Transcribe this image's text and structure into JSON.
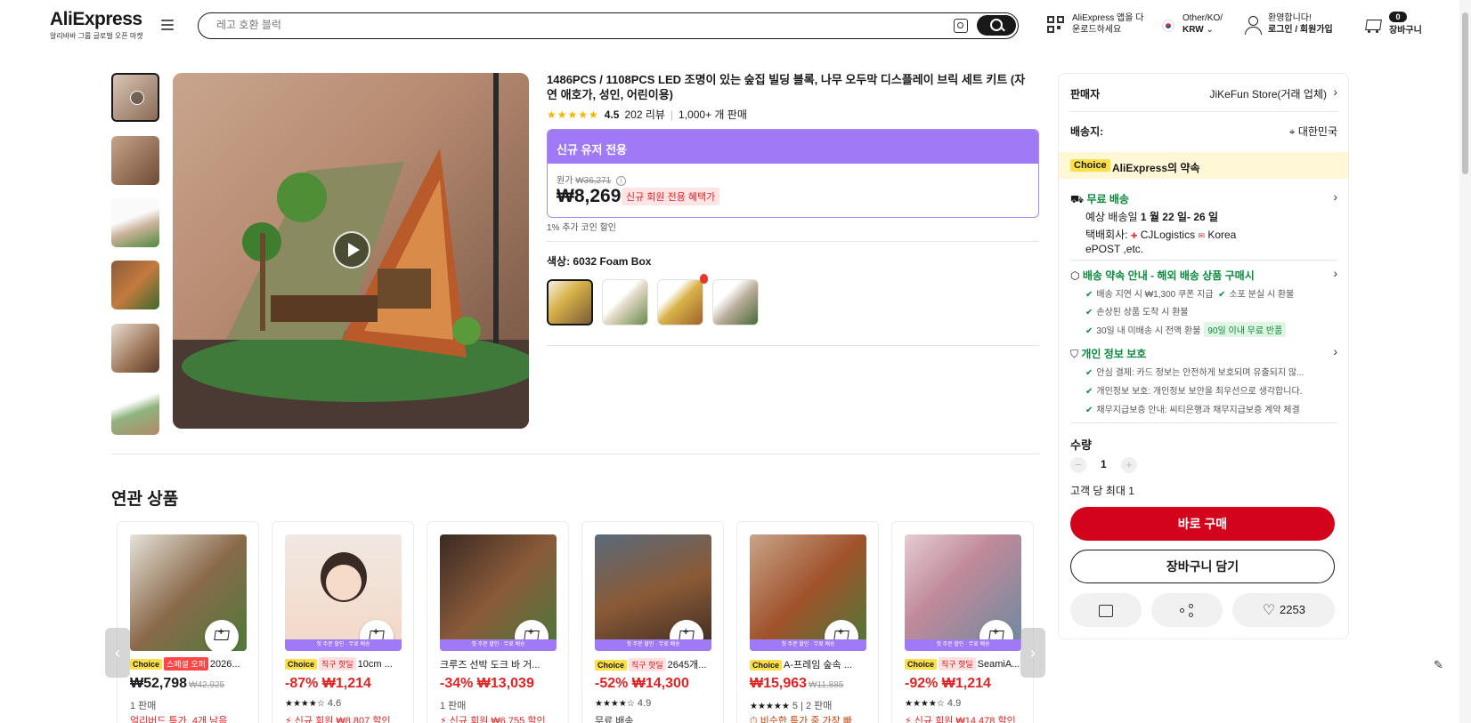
{
  "header": {
    "brand": "AliExpress",
    "brand_sub": "알리바바 그룹 글로벌 오픈 마켓",
    "search_placeholder": "레고 호환 블럭",
    "app_line1": "AliExpress 앱을 다",
    "app_line2": "운로드하세요",
    "locale_line1": "Other/KO/",
    "locale_line2": "KRW",
    "user_line1": "환영합니다!",
    "user_line2": "로그인 / 회원가입",
    "cart_count": "0",
    "cart_label": "장바구니"
  },
  "product": {
    "title": "1486PCS / 1108PCS LED 조명이 있는 숲집 빌딩 블록, 나무 오두막 디스플레이 브릭 세트 키트 (자연 애호가, 성인, 어린이용)",
    "stars": "★★★★★",
    "rating": "4.5",
    "reviews": "202 리뷰",
    "sold": "1,000+ 개 판매",
    "promo_title": "신규 유저 전용",
    "orig_label": "원가",
    "orig_price": "₩36,271",
    "price": "₩8,269",
    "new_member_tag": "신규 회원 전용 혜택가",
    "coin_note": "1% 추가 코인 할인",
    "color_label": "색상: 6032 Foam Box"
  },
  "related": {
    "title": "연관 상품",
    "cards": [
      {
        "tag1": "Choice",
        "tag2": "스페셜 오퍼",
        "name": "2026...",
        "price": "₩52,798",
        "orig": "₩42,925",
        "meta": "1 판매",
        "promo": "얼리버드 특가, 4개 남음"
      },
      {
        "tag1": "Choice",
        "tag2": "직구 핫딜",
        "name": "10cm ...",
        "strip": "첫 주문 할인 · 무료 배송",
        "price": "-87% ₩1,214",
        "stars": "★★★★☆",
        "meta": "4.6",
        "promo": "신규 회원 ₩8,807 할인"
      },
      {
        "name": "크루즈 선박 도크 바 거...",
        "strip": "첫 주문 할인 · 무료 배송",
        "price": "-34% ₩13,039",
        "meta": "1 판매",
        "promo": "신규 회원 ₩6,755 할인"
      },
      {
        "tag1": "Choice",
        "tag2": "직구 핫딜",
        "name": "2645개...",
        "strip": "첫 주문 할인 · 무료 배송",
        "price": "-52% ₩14,300",
        "stars": "★★★★☆",
        "meta": "4.9",
        "promo": "무료 배송"
      },
      {
        "tag1": "Choice",
        "name": "A-프레임 숲속 ...",
        "strip": "첫 주문 할인 · 무료 배송",
        "price": "₩15,963",
        "orig": "₩11,885",
        "stars": "★★★★★",
        "meta": "5 | 2 판매",
        "promo": "비슷한 특가 중 가장 빠"
      },
      {
        "tag1": "Choice",
        "tag2": "직구 핫딜",
        "name": "SeamiA...",
        "strip": "첫 주문 할인 · 무료 배송",
        "price": "-92% ₩1,214",
        "stars": "★★★★☆",
        "meta": "4.9",
        "promo": "신규 회원 ₩14,478 할인"
      }
    ]
  },
  "panel": {
    "seller_label": "판매자",
    "seller_value": "JiKeFun Store(거래 업체)",
    "ship_label": "배송지:",
    "ship_value": "대한민국",
    "choice_tag": "Choice",
    "choice_text": "AliExpress의 약속",
    "free_ship": "무료 배송",
    "eta_prefix": "예상 배송일",
    "eta_value": "1 월 22 일- 26 일",
    "carrier_prefix": "택배회사:",
    "carrier_1": "CJLogistics",
    "carrier_2": "Korea",
    "carrier_3": "ePOST ,etc.",
    "promise_title": "배송 약속 안내 - 해외 배송 상품 구매시",
    "promise_1": "배송 지연 시 ₩1,300 쿠폰 지급",
    "promise_2": "소포 분실 시 환불",
    "promise_3": "손상된 상품 도착 시 환불",
    "promise_4": "30일 내 미배송 시 전액 환불",
    "promise_tag": "90일 이내 무료 반품",
    "privacy_title": "개인 정보 보호",
    "privacy_1": "안심 결제: 카드 정보는 안전하게 보호되며 유출되지 않...",
    "privacy_2": "개인정보 보호: 개인정보 보안을 최우선으로 생각합니다.",
    "privacy_3": "채무지급보증 안내: 씨티은행과 채무지급보증 계약 체결",
    "qty_label": "수량",
    "qty_value": "1",
    "qty_limit": "고객 당 최대 1",
    "buy_now": "바로 구매",
    "add_cart": "장바구니 담기",
    "wish_count": "2253"
  }
}
